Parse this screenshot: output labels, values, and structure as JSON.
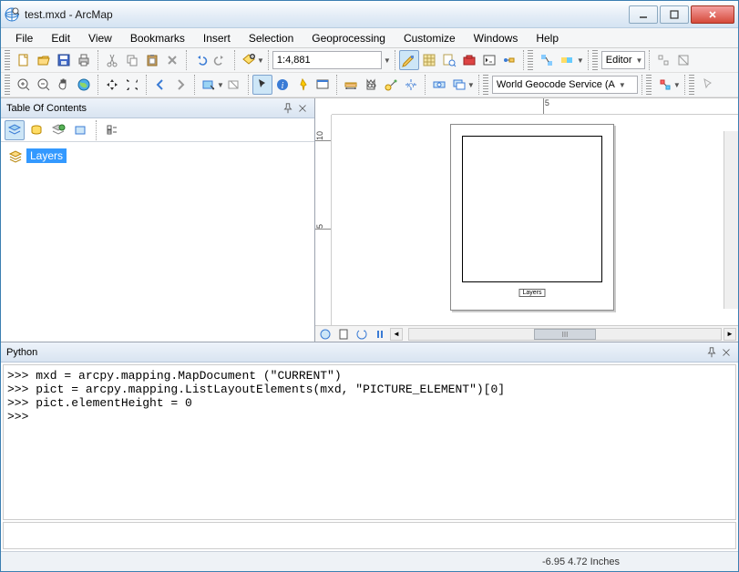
{
  "window": {
    "title": "test.mxd - ArcMap"
  },
  "menu": {
    "items": [
      "File",
      "Edit",
      "View",
      "Bookmarks",
      "Insert",
      "Selection",
      "Geoprocessing",
      "Customize",
      "Windows",
      "Help"
    ]
  },
  "toolbar": {
    "scale": "1:4,881",
    "editor_label": "Editor",
    "geocode_label": "World Geocode Service (A"
  },
  "toc": {
    "title": "Table Of Contents",
    "root_label": "Layers"
  },
  "layout": {
    "ruler_h_tick": "5",
    "ruler_v_tick1": "10",
    "ruler_v_tick2": "5",
    "legend_text": "Layers",
    "scroll_mark": "III"
  },
  "python": {
    "title": "Python",
    "lines": [
      ">>> mxd = arcpy.mapping.MapDocument (\"CURRENT\")",
      ">>> pict = arcpy.mapping.ListLayoutElements(mxd, \"PICTURE_ELEMENT\")[0]",
      ">>> pict.elementHeight = 0",
      ">>> "
    ]
  },
  "status": {
    "coords": "-6.95 4.72 Inches"
  }
}
